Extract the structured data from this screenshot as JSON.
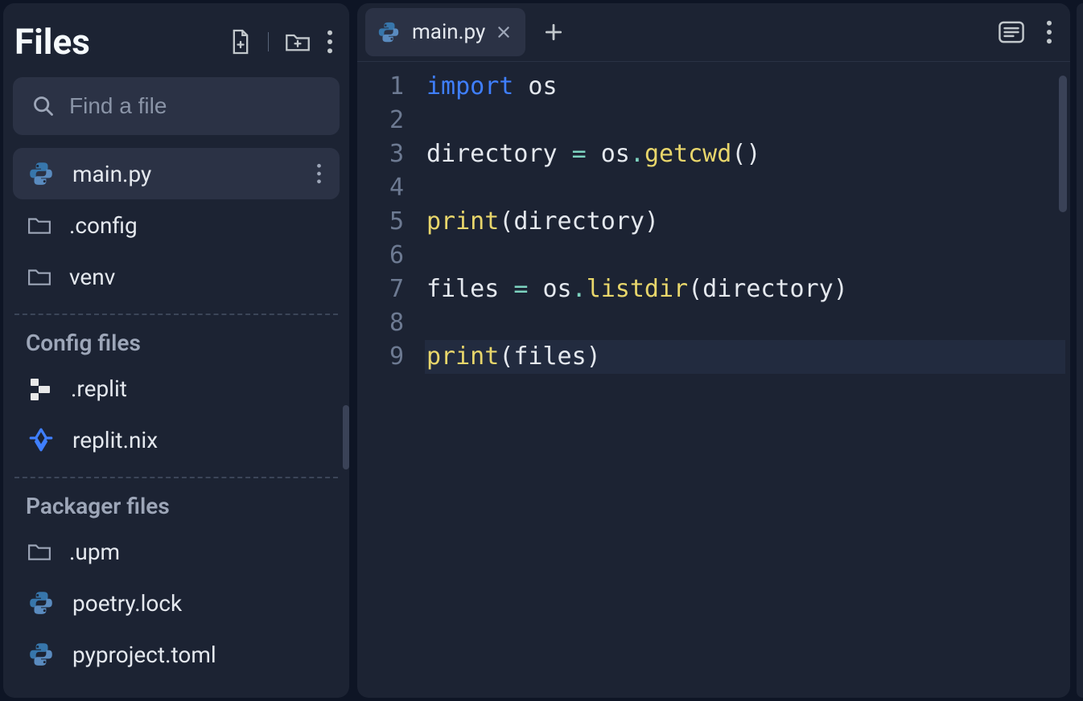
{
  "sidebar": {
    "title": "Files",
    "search_placeholder": "Find a file",
    "files": [
      {
        "name": "main.py",
        "icon": "python"
      },
      {
        "name": ".config",
        "icon": "folder"
      },
      {
        "name": "venv",
        "icon": "folder"
      }
    ],
    "sections": [
      {
        "label": "Config files",
        "items": [
          {
            "name": ".replit",
            "icon": "replit"
          },
          {
            "name": "replit.nix",
            "icon": "nix"
          }
        ]
      },
      {
        "label": "Packager files",
        "items": [
          {
            "name": ".upm",
            "icon": "folder"
          },
          {
            "name": "poetry.lock",
            "icon": "python"
          },
          {
            "name": "pyproject.toml",
            "icon": "python"
          }
        ]
      }
    ]
  },
  "editor": {
    "tab": {
      "title": "main.py"
    },
    "line_numbers": [
      "1",
      "2",
      "3",
      "4",
      "5",
      "6",
      "7",
      "8",
      "9"
    ],
    "code": {
      "l1_kw": "import",
      "l1_mod": " os",
      "l3_a": "directory ",
      "l3_eq": "=",
      "l3_b": " os",
      "l3_dot": ".",
      "l3_fn": "getcwd",
      "l3_p": "()",
      "l5_fn": "print",
      "l5_p": "(directory)",
      "l7_a": "files ",
      "l7_eq": "=",
      "l7_b": " os",
      "l7_dot": ".",
      "l7_fn": "listdir",
      "l7_p": "(directory)",
      "l9_fn": "print",
      "l9_p": "(files)"
    }
  }
}
